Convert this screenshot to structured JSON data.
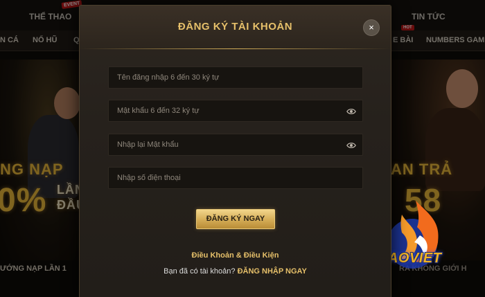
{
  "topnav": {
    "items": [
      {
        "label": "THỂ THAO"
      },
      {
        "label": "TIN TỨC"
      }
    ],
    "event_badge": "EVENT"
  },
  "subnav": {
    "items": [
      {
        "label": "N CÁ"
      },
      {
        "label": "NỔ HŨ"
      },
      {
        "label": "Q"
      },
      {
        "label": "E BÀI"
      },
      {
        "label": "NUMBERS GAME"
      }
    ],
    "hot_badge": "HOT"
  },
  "banner_left": {
    "line1": "NG NẠP",
    "line2": "0%",
    "line3a": "LẦN",
    "line3b": "ĐẦU",
    "footer": "ƯỚNG NẠP LẦN 1"
  },
  "banner_right": {
    "line1": "AN TRẢ",
    "line2": "58",
    "footer": "RA KHÔNG GIỚI H"
  },
  "modal": {
    "title": "ĐĂNG KÝ TÀI KHOẢN",
    "close_icon": "×",
    "fields": [
      {
        "placeholder": "Tên đăng nhập 6 đến 30 ký tự",
        "value": ""
      },
      {
        "placeholder": "Mật khẩu 6 đến 32 ký tự",
        "value": ""
      },
      {
        "placeholder": "Nhập lại Mật khẩu",
        "value": ""
      },
      {
        "placeholder": "Nhập số điện thoại",
        "value": ""
      }
    ],
    "submit_label": "ĐĂNG KÝ NGAY",
    "terms_label": "Điều Khoản & Điều Kiện",
    "login_prompt": "Bạn đã có tài khoản?",
    "login_link": "ĐĂNG NHẬP NGAY"
  },
  "logo": {
    "text": "CAOVIET"
  },
  "colors": {
    "gold": "#e6c06a",
    "button_gold": "#d4ac56",
    "modal_bg": "#26211c",
    "input_bg": "#171410"
  }
}
